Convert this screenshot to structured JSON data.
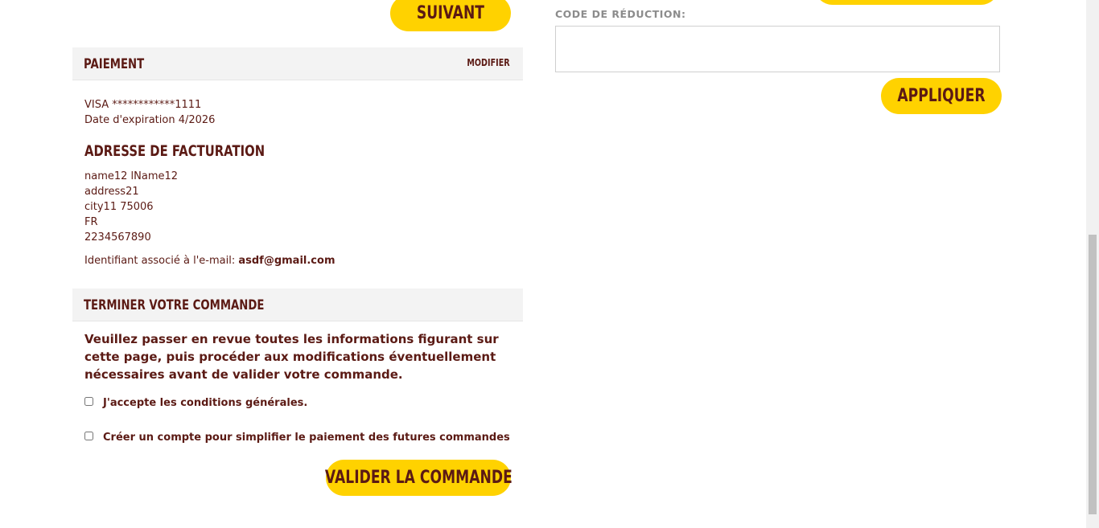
{
  "buttons": {
    "next": "SUIVANT",
    "apply": "APPLIQUER",
    "submit_order": "VALIDER LA COMMANDE"
  },
  "discount": {
    "label": "CODE DE RÉDUCTION:",
    "value": ""
  },
  "payment": {
    "title": "PAIEMENT",
    "modify": "MODIFIER",
    "card": "VISA ************1111",
    "expiry": "Date d'expiration 4/2026"
  },
  "billing": {
    "title": "ADRESSE DE FACTURATION",
    "name": "name12 lName12",
    "address": "address21",
    "city": "city11 75006",
    "country": "FR",
    "phone": "2234567890",
    "email_label": "Identifiant associé à l'e-mail:",
    "email": "asdf@gmail.com"
  },
  "finish": {
    "title": "TERMINER VOTRE COMMANDE",
    "instructions": "Veuillez passer en revue toutes les informations figurant sur cette page, puis procéder aux modifications éventuellement nécessaires avant de valider votre commande.",
    "terms_label": "J'accepte les conditions générales.",
    "create_account_label": "Créer un compte pour simplifier le paiement des futures commandes"
  },
  "colors": {
    "accent": "#ffd200",
    "text": "#5b1a14",
    "section_bg": "#f3f3f3"
  }
}
